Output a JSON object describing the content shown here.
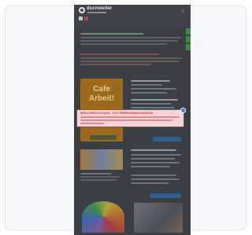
{
  "site": {
    "logo_text": "dscnweiter"
  },
  "promo": {
    "title": "Cafe Arbeit!"
  },
  "overlay": {
    "title": "BENACHRICHTIGUNG - ICHT ERREICHBAR/LENKBAR"
  },
  "colors": {
    "accent_green": "#3d8b40",
    "overlay_border": "#c0392b",
    "overlay_bg": "#f4d4d8",
    "promo_bg": "#9b6a1f",
    "button_blue": "#2f5f8f"
  }
}
